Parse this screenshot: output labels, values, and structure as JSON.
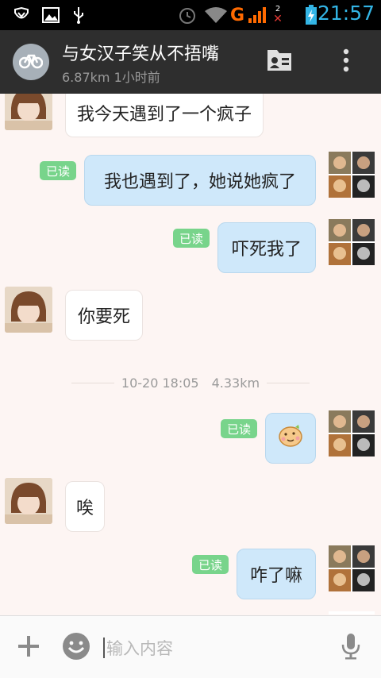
{
  "status_bar": {
    "time": "21:57",
    "icons": [
      "shield-icon",
      "image-icon",
      "usb-icon",
      "alarm-icon",
      "wifi-icon",
      "g-network-icon",
      "signal-icon",
      "no-signal-icon",
      "battery-charging-icon"
    ],
    "network_letter": "G",
    "sim_number": "2"
  },
  "header": {
    "title": "与女汉子笑从不捂嘴",
    "subtitle": "6.87km 1小时前",
    "avatar_icon": "bicycle-icon",
    "profile_icon": "profile-card-icon",
    "menu_icon": "more-vertical-icon"
  },
  "messages": [
    {
      "side": "left",
      "text": "我今天遇到了一个疯子"
    },
    {
      "side": "right",
      "text": "我也遇到了，她说她疯了",
      "read": "已读"
    },
    {
      "side": "right",
      "text": "吓死我了",
      "read": "已读"
    },
    {
      "side": "left",
      "text": "你要死"
    },
    {
      "side": "right",
      "emoji": "cookie-emoji",
      "read": "已读"
    },
    {
      "side": "left",
      "text": "唉"
    },
    {
      "side": "right",
      "text": "咋了嘛",
      "read": "已读"
    }
  ],
  "divider": {
    "datetime": "10-20 18:05",
    "distance": "4.33km"
  },
  "input": {
    "placeholder": "输入内容",
    "plus_icon": "plus-icon",
    "emoji_icon": "smiley-icon",
    "mic_icon": "microphone-icon"
  },
  "colors": {
    "status_time": "#33b5e5",
    "header_bg": "#2e2e2e",
    "chat_bg": "#fdf5f3",
    "bubble_right": "#cfe8fa",
    "read_badge": "#78d48b"
  }
}
